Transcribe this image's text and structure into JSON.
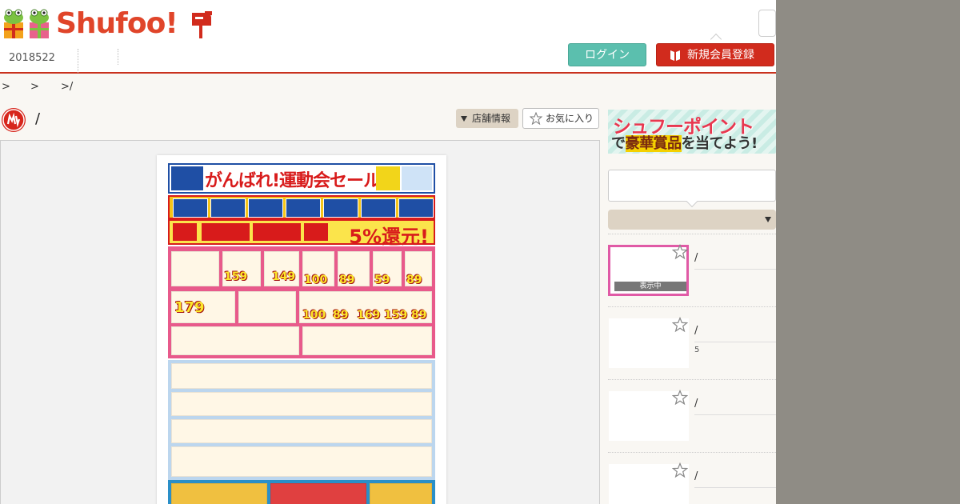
{
  "header": {
    "logo_text": "Shufoo!",
    "login_label": "ログイン",
    "register_label": "新規会員登録",
    "date_tab": "2018522"
  },
  "breadcrumb": [
    ">",
    ">",
    ">/"
  ],
  "store": {
    "name": "/",
    "store_info_label": "店舗情報",
    "favorite_label": "お気に入り"
  },
  "flyer_image": {
    "title": "がんばれ!運動会セール",
    "percent_back": "5%還元!",
    "prices": [
      "159",
      "149",
      "100",
      "89",
      "59",
      "89",
      "179",
      "100",
      "89",
      "169",
      "159",
      "89"
    ]
  },
  "sidebar": {
    "banner_line1": "シュフーポイント",
    "banner_line2_pre": "で",
    "banner_line2_hl": "豪華賞品",
    "banner_line2_post": "を当てよう!",
    "flyers": [
      {
        "title": "/",
        "sub": "",
        "active": true,
        "badge": "表示中"
      },
      {
        "title": "/",
        "sub": "5",
        "active": false
      },
      {
        "title": "/",
        "sub": "",
        "active": false
      },
      {
        "title": "/",
        "sub": "",
        "active": false
      }
    ]
  },
  "colors": {
    "brand_red": "#d12b1d",
    "login_teal": "#5bbfae",
    "active_thumb": "#e05aa6"
  }
}
